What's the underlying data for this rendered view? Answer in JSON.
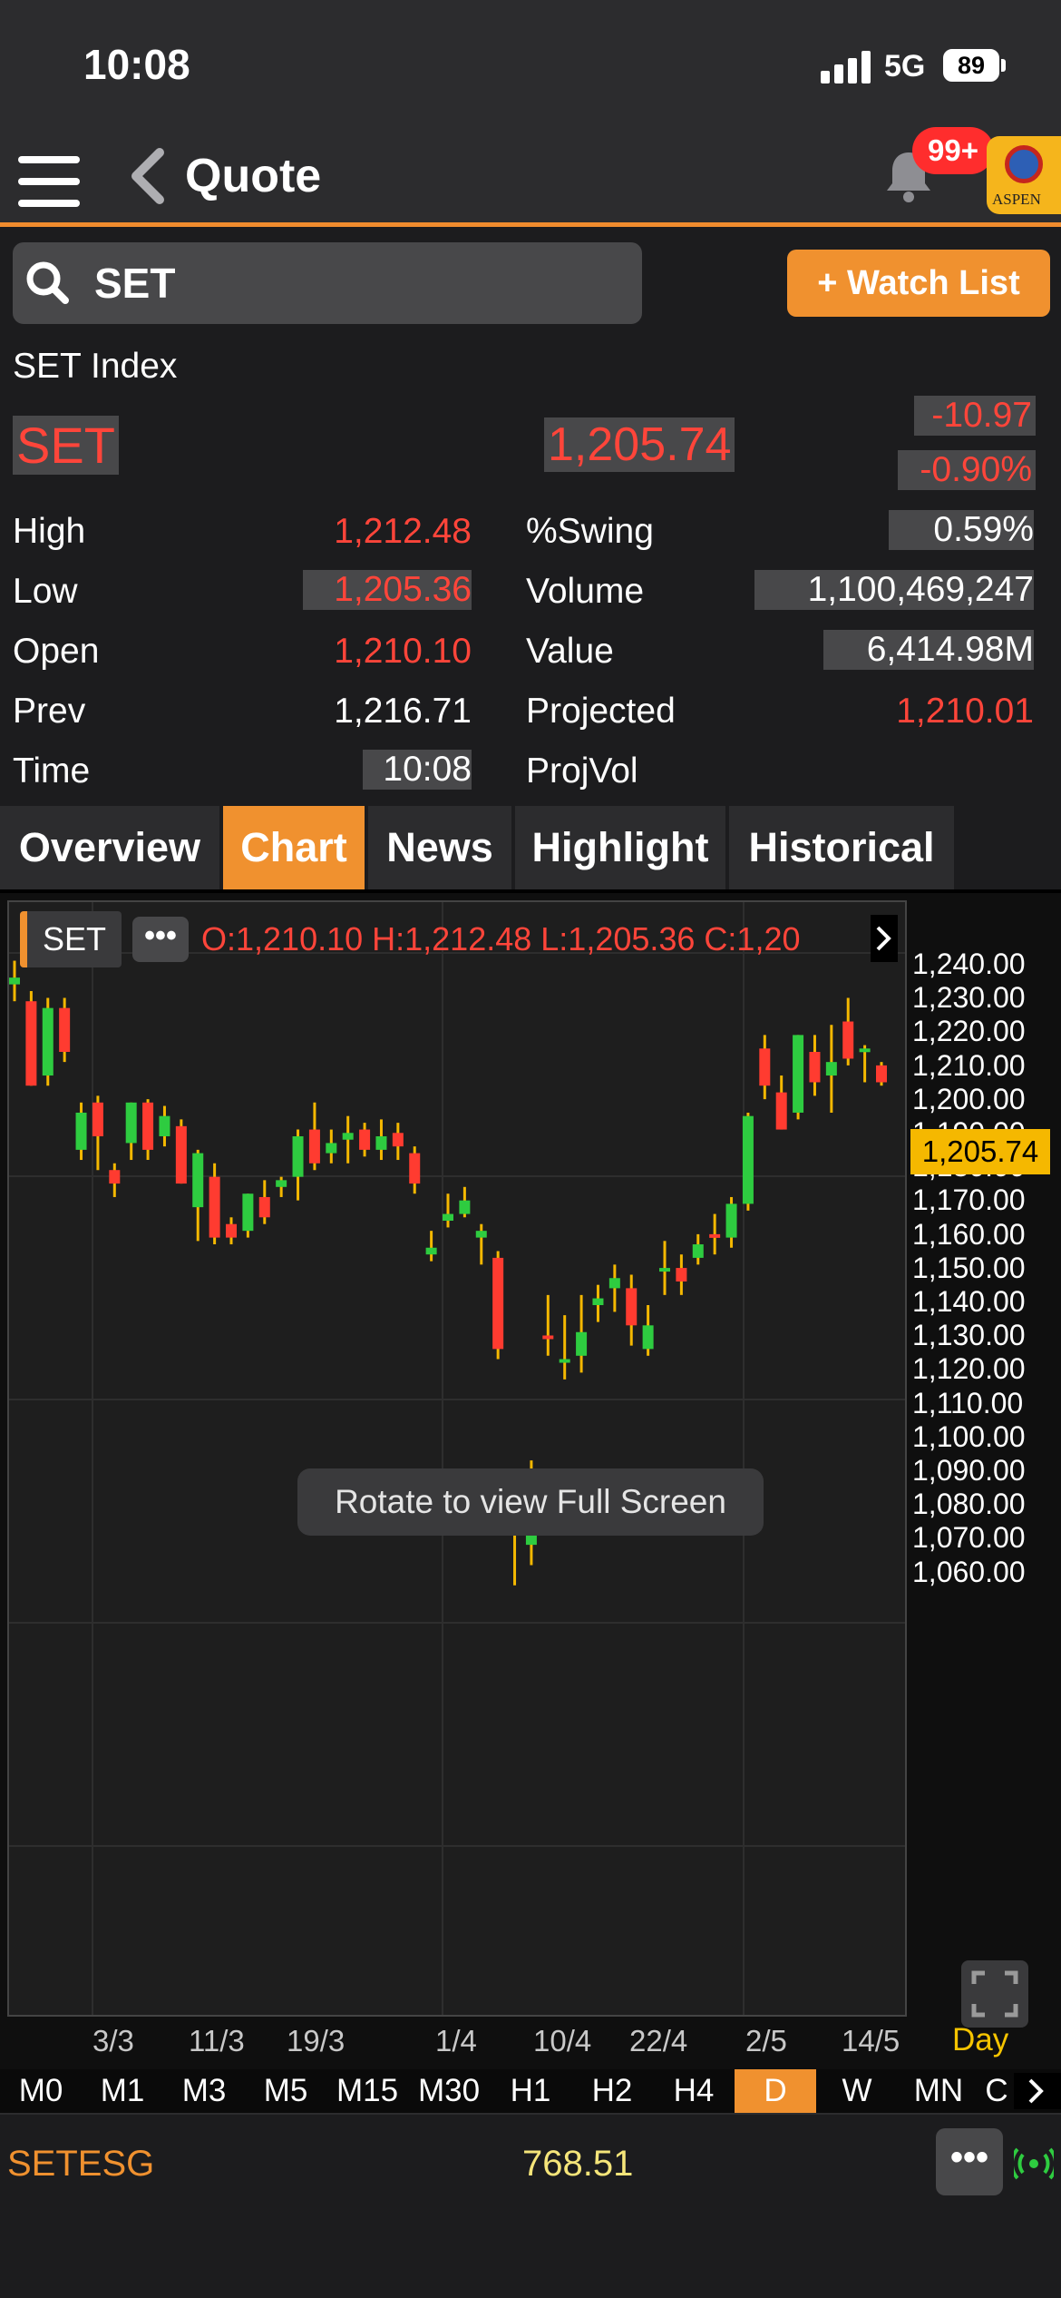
{
  "status_bar": {
    "time": "10:08",
    "network": "5G",
    "battery": "89"
  },
  "nav": {
    "title": "Quote",
    "notification_badge": "99+",
    "logo_text": "ASPEN"
  },
  "search": {
    "value": "SET"
  },
  "watch_list_label": "+ Watch List",
  "quote": {
    "name": "SET Index",
    "symbol": "SET",
    "last": "1,205.74",
    "change": "-10.97",
    "change_pct": "-0.90%",
    "left_rows": [
      {
        "label": "High",
        "value": "1,212.48"
      },
      {
        "label": "Low",
        "value": "1,205.36"
      },
      {
        "label": "Open",
        "value": "1,210.10"
      },
      {
        "label": "Prev",
        "value": "1,216.71"
      },
      {
        "label": "Time",
        "value": "10:08"
      }
    ],
    "right_rows": [
      {
        "label": "%Swing",
        "value": "0.59%"
      },
      {
        "label": "Volume",
        "value": "1,100,469,247"
      },
      {
        "label": "Value",
        "value": "6,414.98M"
      },
      {
        "label": "Projected",
        "value": "1,210.01"
      },
      {
        "label": "ProjVol",
        "value": ""
      }
    ]
  },
  "tabs": [
    "Overview",
    "Chart",
    "News",
    "Highlight",
    "Historical"
  ],
  "active_tab": "Chart",
  "chart_header": {
    "symbol": "SET",
    "more": "•••",
    "ohlc": "O:1,210.10  H:1,212.48  L:1,205.36  C:1,20"
  },
  "chart_overlay": "Rotate to view Full Screen",
  "current_price_tag": "1,205.74",
  "x_period_label": "Day",
  "timeframes": [
    "M0",
    "M1",
    "M3",
    "M5",
    "M15",
    "M30",
    "H1",
    "H2",
    "H4",
    "D",
    "W",
    "MN",
    "C"
  ],
  "active_timeframe": "D",
  "bottom_ticker": {
    "symbol": "SETESG",
    "value": "768.51",
    "more": "•••"
  },
  "colors": {
    "up": "#2ecc40",
    "down": "#ff3b30",
    "wick": "#f5b800",
    "accent": "#f0912f"
  },
  "chart_data": {
    "type": "candlestick",
    "y_ticks": [
      "1,240.00",
      "1,230.00",
      "1,220.00",
      "1,210.00",
      "1,200.00",
      "1,190.00",
      "1,180.00",
      "1,170.00",
      "1,160.00",
      "1,150.00",
      "1,140.00",
      "1,130.00",
      "1,120.00",
      "1,110.00",
      "1,100.00",
      "1,090.00",
      "1,080.00",
      "1,070.00",
      "1,060.00"
    ],
    "x_ticks": [
      "3/3",
      "11/3",
      "19/3",
      "1/4",
      "10/4",
      "22/4",
      "2/5",
      "14/5"
    ],
    "ylim": [
      1052,
      1243
    ],
    "candles": [
      {
        "o": 1235,
        "h": 1242,
        "l": 1230,
        "c": 1237
      },
      {
        "o": 1230,
        "h": 1233,
        "l": 1205,
        "c": 1205
      },
      {
        "o": 1208,
        "h": 1231,
        "l": 1205,
        "c": 1228
      },
      {
        "o": 1228,
        "h": 1231,
        "l": 1212,
        "c": 1215
      },
      {
        "o": 1186,
        "h": 1200,
        "l": 1183,
        "c": 1197
      },
      {
        "o": 1200,
        "h": 1202,
        "l": 1180,
        "c": 1190
      },
      {
        "o": 1180,
        "h": 1182,
        "l": 1172,
        "c": 1176
      },
      {
        "o": 1188,
        "h": 1200,
        "l": 1183,
        "c": 1200
      },
      {
        "o": 1200,
        "h": 1201,
        "l": 1183,
        "c": 1186
      },
      {
        "o": 1190,
        "h": 1199,
        "l": 1187,
        "c": 1196
      },
      {
        "o": 1193,
        "h": 1195,
        "l": 1176,
        "c": 1176
      },
      {
        "o": 1169,
        "h": 1186,
        "l": 1159,
        "c": 1185
      },
      {
        "o": 1178,
        "h": 1182,
        "l": 1158,
        "c": 1160
      },
      {
        "o": 1164,
        "h": 1166,
        "l": 1158,
        "c": 1160
      },
      {
        "o": 1162,
        "h": 1173,
        "l": 1160,
        "c": 1173
      },
      {
        "o": 1172,
        "h": 1177,
        "l": 1164,
        "c": 1166
      },
      {
        "o": 1175,
        "h": 1178,
        "l": 1172,
        "c": 1177
      },
      {
        "o": 1178,
        "h": 1192,
        "l": 1171,
        "c": 1190
      },
      {
        "o": 1192,
        "h": 1200,
        "l": 1180,
        "c": 1182
      },
      {
        "o": 1185,
        "h": 1192,
        "l": 1182,
        "c": 1188
      },
      {
        "o": 1189,
        "h": 1196,
        "l": 1182,
        "c": 1191
      },
      {
        "o": 1192,
        "h": 1194,
        "l": 1184,
        "c": 1186
      },
      {
        "o": 1186,
        "h": 1195,
        "l": 1183,
        "c": 1190
      },
      {
        "o": 1191,
        "h": 1194,
        "l": 1183,
        "c": 1187
      },
      {
        "o": 1185,
        "h": 1187,
        "l": 1173,
        "c": 1176
      },
      {
        "o": 1155,
        "h": 1162,
        "l": 1153,
        "c": 1157
      },
      {
        "o": 1165,
        "h": 1173,
        "l": 1163,
        "c": 1167
      },
      {
        "o": 1167,
        "h": 1175,
        "l": 1166,
        "c": 1171
      },
      {
        "o": 1160,
        "h": 1164,
        "l": 1152,
        "c": 1162
      },
      {
        "o": 1154,
        "h": 1156,
        "l": 1124,
        "c": 1127
      },
      {
        "o": 1077,
        "h": 1079,
        "l": 1057,
        "c": 1075
      },
      {
        "o": 1069,
        "h": 1094,
        "l": 1063,
        "c": 1086
      },
      {
        "o": 1131,
        "h": 1143,
        "l": 1125,
        "c": 1130
      },
      {
        "o": 1124,
        "h": 1137,
        "l": 1118,
        "c": 1124
      },
      {
        "o": 1125,
        "h": 1143,
        "l": 1120,
        "c": 1132
      },
      {
        "o": 1140,
        "h": 1146,
        "l": 1135,
        "c": 1142
      },
      {
        "o": 1145,
        "h": 1152,
        "l": 1138,
        "c": 1148
      },
      {
        "o": 1145,
        "h": 1149,
        "l": 1128,
        "c": 1134
      },
      {
        "o": 1127,
        "h": 1140,
        "l": 1125,
        "c": 1134
      },
      {
        "o": 1151,
        "h": 1159,
        "l": 1143,
        "c": 1151
      },
      {
        "o": 1151,
        "h": 1155,
        "l": 1143,
        "c": 1147
      },
      {
        "o": 1154,
        "h": 1161,
        "l": 1152,
        "c": 1158
      },
      {
        "o": 1161,
        "h": 1167,
        "l": 1155,
        "c": 1160
      },
      {
        "o": 1160,
        "h": 1172,
        "l": 1157,
        "c": 1170
      },
      {
        "o": 1170,
        "h": 1197,
        "l": 1168,
        "c": 1196
      },
      {
        "o": 1216,
        "h": 1220,
        "l": 1201,
        "c": 1205
      },
      {
        "o": 1203,
        "h": 1208,
        "l": 1192,
        "c": 1192
      },
      {
        "o": 1197,
        "h": 1220,
        "l": 1195,
        "c": 1220
      },
      {
        "o": 1215,
        "h": 1220,
        "l": 1202,
        "c": 1206
      },
      {
        "o": 1208,
        "h": 1223,
        "l": 1197,
        "c": 1212
      },
      {
        "o": 1224,
        "h": 1231,
        "l": 1211,
        "c": 1213
      },
      {
        "o": 1215,
        "h": 1217,
        "l": 1206,
        "c": 1216
      },
      {
        "o": 1211,
        "h": 1212,
        "l": 1205,
        "c": 1206
      }
    ]
  }
}
